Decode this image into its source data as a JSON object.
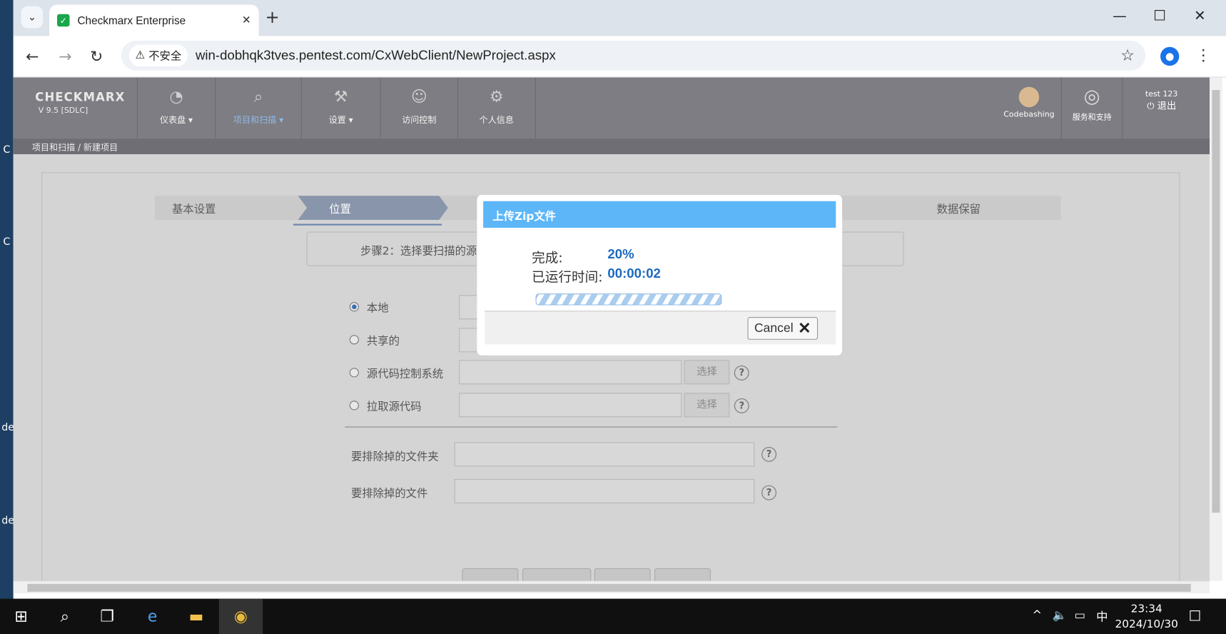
{
  "desktop_labels": [
    "C",
    "C",
    "de",
    "de"
  ],
  "browser": {
    "tab_title": "Checkmarx Enterprise",
    "insecure_label": "不安全",
    "url": "win-dobhqk3tves.pentest.com/CxWebClient/NewProject.aspx"
  },
  "app": {
    "logo": "CHECKMARX",
    "version": "V 9.5  [SDLC]",
    "menu": [
      {
        "label": "仪表盘",
        "icon": "gauge-icon"
      },
      {
        "label": "项目和扫描",
        "icon": "project-scan-icon"
      },
      {
        "label": "设置",
        "icon": "wrench-icon"
      },
      {
        "label": "访问控制",
        "icon": "users-icon"
      },
      {
        "label": "个人信息",
        "icon": "user-gear-icon"
      }
    ],
    "codebashing": "Codebashing",
    "support": "服务和支持",
    "user": "test 123",
    "logout": "退出",
    "breadcrumb": "项目和扫描 / 新建项目"
  },
  "wizard": {
    "steps": [
      "基本设置",
      "位置",
      "数据保留"
    ],
    "note": "步骤2：选择要扫描的源",
    "options": [
      "本地",
      "共享的",
      "源代码控制系统",
      "拉取源代码"
    ],
    "select_label": "选择",
    "exclude_folders": "要排除掉的文件夹",
    "exclude_files": "要排除掉的文件"
  },
  "dialog": {
    "title": "上传Zip文件",
    "done_label": "完成:",
    "done_value": "20%",
    "elapsed_label": "已运行时间:",
    "elapsed_value": "00:00:02",
    "cancel": "Cancel",
    "progress": 0.2
  },
  "taskbar": {
    "ime": "中",
    "time": "23:34",
    "date": "2024/10/30"
  },
  "colors": {
    "dialog_header": "#5cb6f8",
    "app_bar": "#7d7d83",
    "accent": "#1b6ac0"
  }
}
